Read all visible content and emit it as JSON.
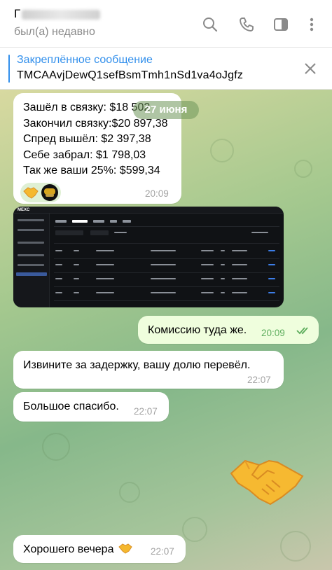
{
  "header": {
    "name_initial": "Г",
    "status": "был(а) недавно",
    "icons": [
      "search-icon",
      "phone-icon",
      "sidebar-icon",
      "more-icon"
    ]
  },
  "pinned": {
    "title": "Закреплённое сообщение",
    "text": "TMCAAvjDewQ1sefBsmTmh1nSd1va4oJgfz"
  },
  "date_chip": "27 июня",
  "messages": {
    "m1": {
      "lines": [
        "Зашёл в связку: $18 502",
        "Закончил связку:$20 897,38",
        "Спред вышёл: $2 397,38",
        "Себе забрал: $1 798,03",
        "Так же ваши 25%: $599,34"
      ],
      "time": "20:09"
    },
    "m2": {
      "text": "Комиссию туда же.",
      "time": "20:09"
    },
    "m3": {
      "text": "Извините за задержку, вашу долю перевёл.",
      "time": "22:07"
    },
    "m4": {
      "text": "Большое спасибо.",
      "time": "22:07"
    },
    "m5": {
      "text": "Хорошего вечера",
      "time": "22:07"
    }
  },
  "screenshot": {
    "logo": "MEXC",
    "tabs": [
      "Deposit",
      "Withdrawal",
      "Transfer",
      "Send",
      "Others"
    ],
    "rows": [
      {
        "coin": "USDT",
        "date": "2024-06-27 19:53:26",
        "status": "Withdrawal Successful",
        "amount": "20,897.3866",
        "fee": "1.0",
        "address": "TMJvut...duRet"
      },
      {
        "coin": "USDT",
        "date": "2024-06-27 19:50:40",
        "status": "Withdrawal Successful",
        "amount": "26,071.2466",
        "fee": "1.0",
        "address": "TMJvut...duRet"
      },
      {
        "coin": "USDT",
        "date": "2024-06-27 17:58:09",
        "status": "Withdrawal Successful",
        "amount": "28,621.9086",
        "fee": "1.0",
        "address": "TMJvut...duRet"
      },
      {
        "coin": "USDT",
        "date": "2024-06-27 17:52:53",
        "status": "Withdrawal Successful",
        "amount": "18,661.5404",
        "fee": "1.0",
        "address": "TMJvut...duRet"
      }
    ]
  },
  "colors": {
    "accent": "#3390ec",
    "outgoing_bubble": "#effedd",
    "check": "#5dad5d"
  }
}
